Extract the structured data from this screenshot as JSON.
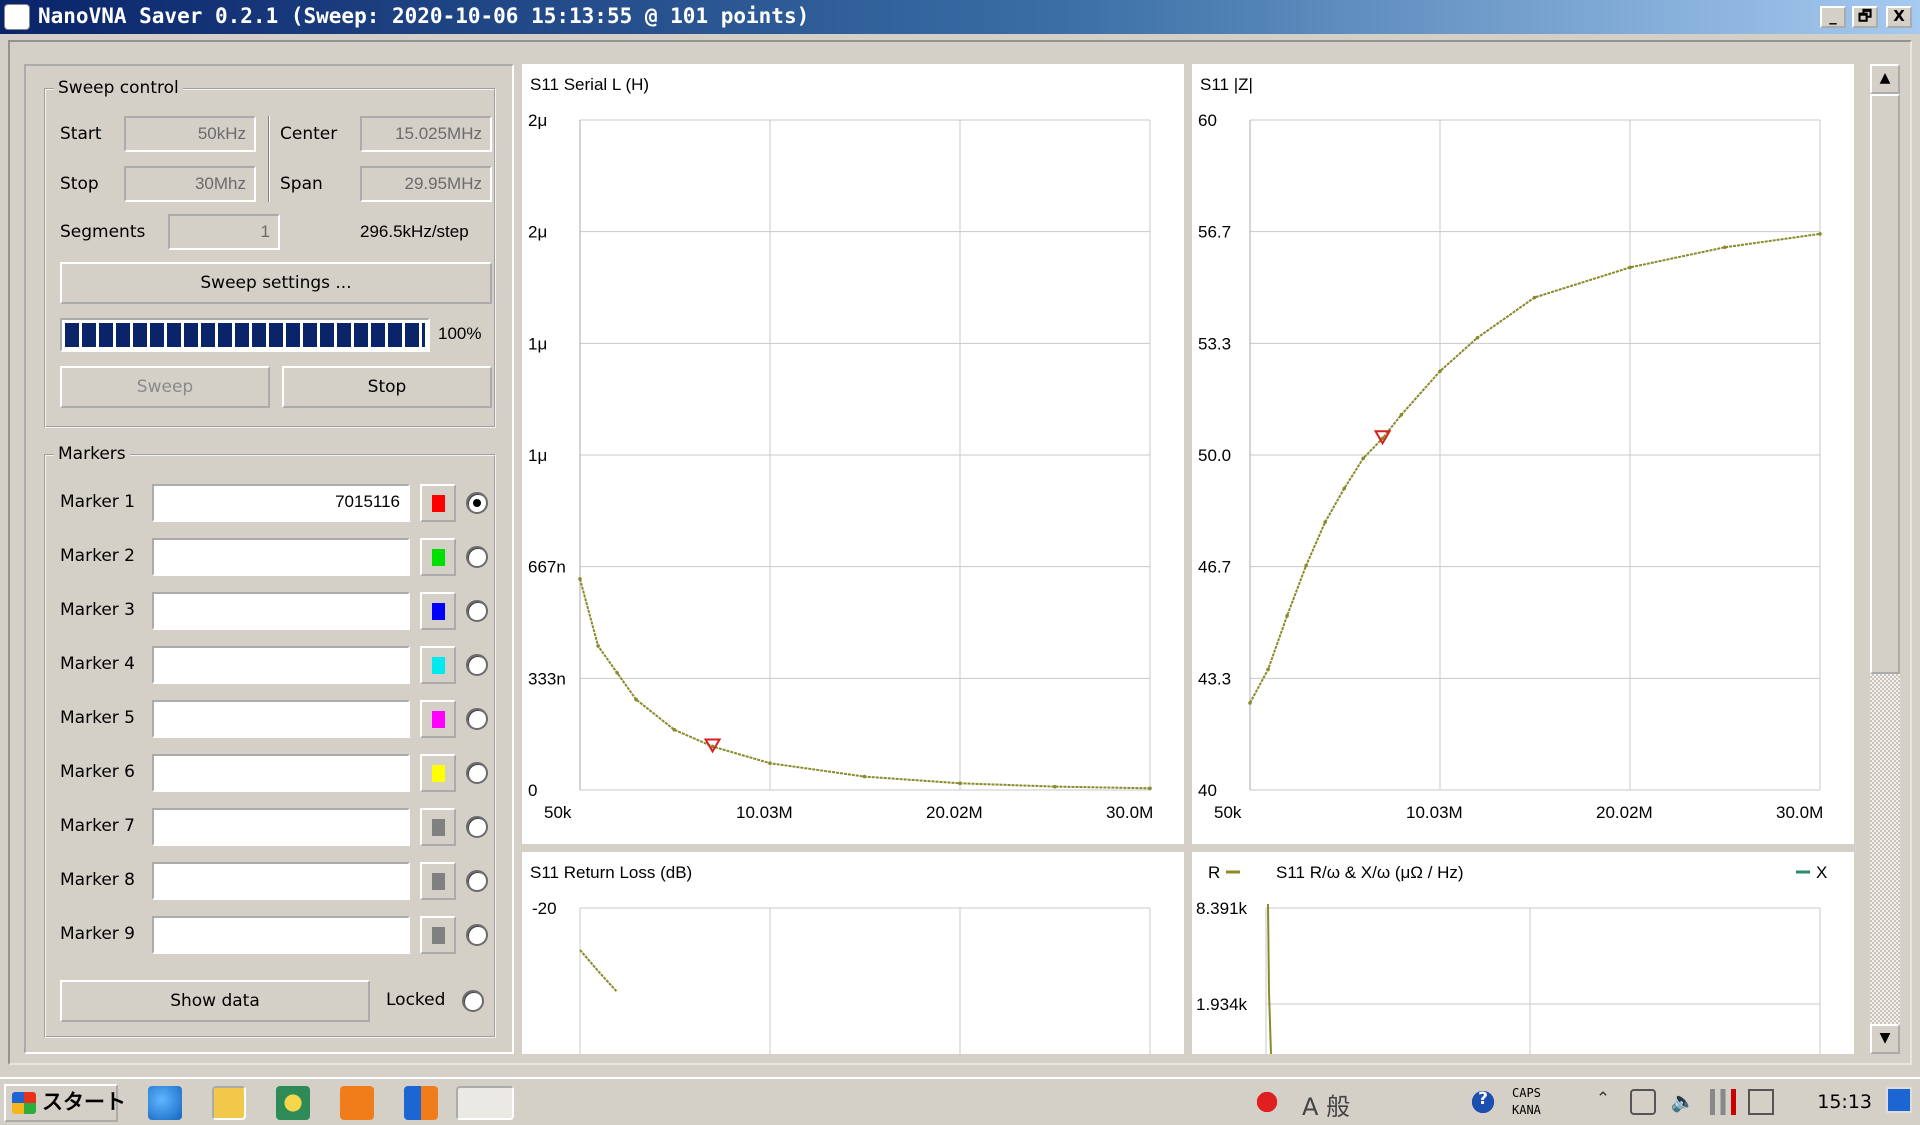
{
  "window": {
    "title": "NanoVNA Saver 0.2.1 (Sweep: 2020-10-06 15:13:55 @ 101 points)",
    "minimize": "_",
    "restore": "🗗",
    "close": "X"
  },
  "sweep": {
    "group_title": "Sweep control",
    "start_label": "Start",
    "start_value": "50kHz",
    "stop_label": "Stop",
    "stop_value": "30Mhz",
    "center_label": "Center",
    "center_value": "15.025MHz",
    "span_label": "Span",
    "span_value": "29.95MHz",
    "segments_label": "Segments",
    "segments_value": "1",
    "step_text": "296.5kHz/step",
    "settings_button": "Sweep settings ...",
    "progress_percent": 100,
    "progress_text": "100%",
    "sweep_button": "Sweep",
    "stop_button": "Stop"
  },
  "markers": {
    "group_title": "Markers",
    "items": [
      {
        "label": "Marker 1",
        "value": "7015116",
        "color": "#ff0000",
        "selected": true
      },
      {
        "label": "Marker 2",
        "value": "",
        "color": "#00e000",
        "selected": false
      },
      {
        "label": "Marker 3",
        "value": "",
        "color": "#0000ff",
        "selected": false
      },
      {
        "label": "Marker 4",
        "value": "",
        "color": "#00e8f0",
        "selected": false
      },
      {
        "label": "Marker 5",
        "value": "",
        "color": "#ff00ff",
        "selected": false
      },
      {
        "label": "Marker 6",
        "value": "",
        "color": "#ffff00",
        "selected": false
      },
      {
        "label": "Marker 7",
        "value": "",
        "color": "#808080",
        "selected": false
      },
      {
        "label": "Marker 8",
        "value": "",
        "color": "#808080",
        "selected": false
      },
      {
        "label": "Marker 9",
        "value": "",
        "color": "#808080",
        "selected": false
      }
    ],
    "show_data_button": "Show data",
    "locked_label": "Locked"
  },
  "charts": {
    "serial_l": {
      "title": "S11 Serial L (H)"
    },
    "impedance": {
      "title": "S11 |Z|"
    },
    "return_loss": {
      "title": "S11 Return Loss (dB)"
    },
    "r_x": {
      "title": "S11 R/ω & X/ω (μΩ / Hz)",
      "legend_r": "R",
      "legend_x": "X"
    }
  },
  "chart_data": [
    {
      "type": "line",
      "title": "S11 Serial L (H)",
      "y_tick_labels": [
        "2μ",
        "2μ",
        "1μ",
        "1μ",
        "667n",
        "333n",
        "0"
      ],
      "x_tick_labels": [
        "50k",
        "10.03M",
        "20.02M",
        "30.0M"
      ],
      "x": [
        0.05,
        1,
        2,
        3,
        5,
        7.015,
        10.03,
        15,
        20.02,
        25,
        30.0
      ],
      "y": [
        6.3e-07,
        4.3e-07,
        3.5e-07,
        2.7e-07,
        1.8e-07,
        1.3e-07,
        8e-08,
        4e-08,
        2e-08,
        1e-08,
        5e-09
      ],
      "ylim": [
        0,
        2e-06
      ],
      "xlim": [
        0.05,
        30.0
      ],
      "line_color": "#8a8a2a",
      "marker": {
        "x": 7.015,
        "y": 1.3e-07,
        "color": "#d62020"
      }
    },
    {
      "type": "line",
      "title": "S11 |Z|",
      "y_tick_labels": [
        "60",
        "56.7",
        "53.3",
        "50.0",
        "46.7",
        "43.3",
        "40"
      ],
      "x_tick_labels": [
        "50k",
        "10.03M",
        "20.02M",
        "30.0M"
      ],
      "x": [
        0.05,
        1,
        2,
        3,
        4,
        5,
        6,
        7.015,
        8,
        10.03,
        12,
        15,
        20.02,
        25,
        30.0
      ],
      "y": [
        42.6,
        43.6,
        45.2,
        46.7,
        48.0,
        49.0,
        49.9,
        50.5,
        51.2,
        52.5,
        53.5,
        54.7,
        55.6,
        56.2,
        56.6
      ],
      "ylim": [
        40,
        60
      ],
      "xlim": [
        0.05,
        30.0
      ],
      "line_color": "#8a8a2a",
      "marker": {
        "x": 7.015,
        "y": 50.5,
        "color": "#d62020"
      }
    },
    {
      "type": "line",
      "title": "S11 Return Loss (dB)",
      "y_tick_labels": [
        "-20"
      ],
      "x_tick_labels": [],
      "x": [
        0.05,
        1,
        2
      ],
      "y": [
        -23,
        -24.5,
        -26
      ],
      "line_color": "#8a8a2a"
    },
    {
      "type": "line",
      "title": "S11 R/ω & X/ω (μΩ / Hz)",
      "y_tick_labels": [
        "8.391k",
        "1.934k"
      ],
      "x_tick_labels": [],
      "series": [
        {
          "name": "R",
          "color": "#8a8a2a"
        },
        {
          "name": "X",
          "color": "#2a8a6a"
        }
      ]
    }
  ],
  "taskbar": {
    "start_label": "スタート",
    "tray_ime_1": "A",
    "tray_ime_2": "般",
    "caps": "CAPS",
    "kana": "KANA",
    "clock": "15:13"
  }
}
